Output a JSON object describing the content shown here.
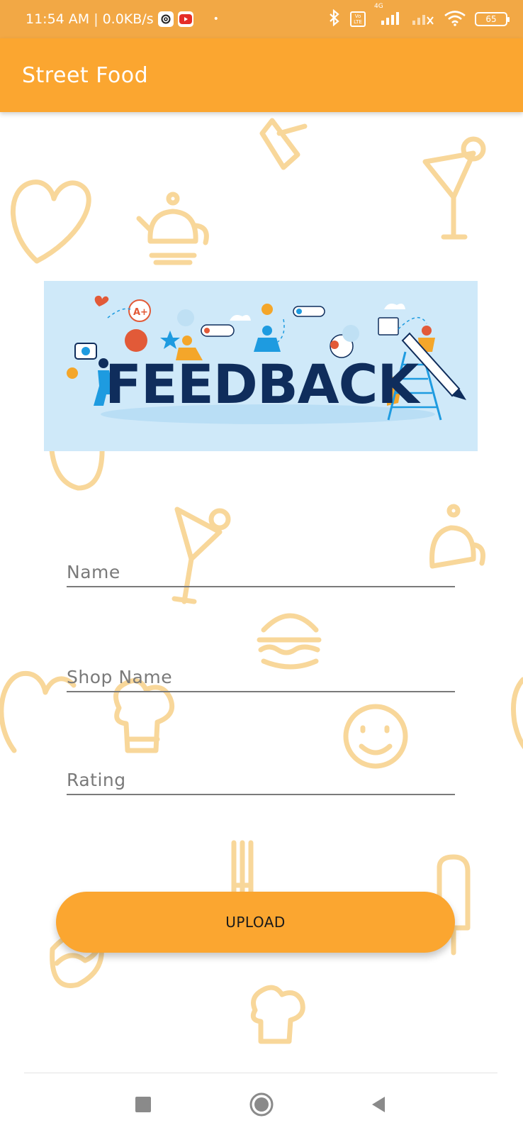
{
  "status_bar": {
    "time": "11:54 AM",
    "separator": "|",
    "net_speed": "0.0KB/s",
    "network_type": "4G",
    "volte": "Vo LTE",
    "battery_level": "65",
    "icons": [
      "threads-icon",
      "youtube-icon",
      "bluetooth-icon",
      "volte-icon",
      "signal-icon",
      "signal-icon",
      "wifi-icon",
      "battery-icon"
    ]
  },
  "app_bar": {
    "title": "Street Food"
  },
  "banner": {
    "word": "FEEDBACK",
    "grade_badge": "A+",
    "colors": {
      "background": "#cfe9f9",
      "word": "#0f2d5c",
      "accent": "#f4a62a",
      "blue": "#1e9be0",
      "red": "#e25a38"
    }
  },
  "form": {
    "name_placeholder": "Name",
    "shop_name_placeholder": "Shop Name",
    "rating_placeholder": "Rating",
    "upload_label": "UPLOAD"
  },
  "nav": {
    "icons": [
      "recents-icon",
      "home-icon",
      "back-icon"
    ]
  },
  "colors": {
    "primary": "#fba630",
    "status_bar": "#f2a845",
    "doodle": "#f8d79a",
    "underline": "#7a7a7a"
  }
}
